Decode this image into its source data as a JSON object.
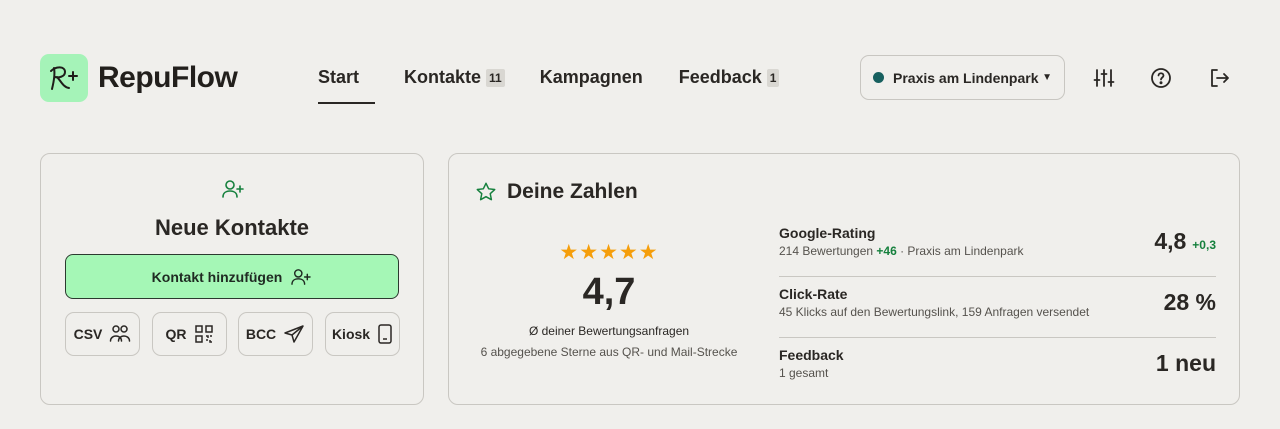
{
  "app": {
    "name": "RepuFlow",
    "logo_icon": "script-r-sparkle-icon"
  },
  "nav": {
    "items": [
      {
        "label": "Start",
        "active": true
      },
      {
        "label": "Kontakte",
        "badge": "11"
      },
      {
        "label": "Kampagnen"
      },
      {
        "label": "Feedback",
        "badge": "1"
      }
    ]
  },
  "header": {
    "practice_select": {
      "value": "Praxis am Lindenpark",
      "status_color": "#17605f"
    },
    "icons": [
      "sliders-icon",
      "help-icon",
      "logout-icon"
    ]
  },
  "contacts_card": {
    "title": "Neue Kontakte",
    "add_button": "Kontakt hinzufügen",
    "import_buttons": [
      {
        "label": "CSV",
        "icon": "users-icon"
      },
      {
        "label": "QR",
        "icon": "qr-code-icon"
      },
      {
        "label": "BCC",
        "icon": "send-icon"
      },
      {
        "label": "Kiosk",
        "icon": "tablet-icon"
      }
    ]
  },
  "stats_card": {
    "title": "Deine Zahlen",
    "average": {
      "stars": "★★★★★",
      "star_count": 5,
      "value": "4,7",
      "label": "Ø deiner Bewertungsanfragen",
      "sub": "6 abgegebene Sterne aus QR- und Mail-Strecke"
    },
    "metrics": [
      {
        "label": "Google-Rating",
        "sub_prefix": "214 Bewertungen ",
        "sub_highlight": "+46",
        "sub_suffix": " · Praxis am Lindenpark",
        "value": "4,8",
        "delta": "+0,3"
      },
      {
        "label": "Click-Rate",
        "sub": "45 Klicks auf den Bewertungslink, 159 Anfragen versendet",
        "value": "28 %"
      },
      {
        "label": "Feedback",
        "sub": "1 gesamt",
        "value": "1 neu"
      }
    ]
  },
  "colors": {
    "accent_green": "#a5f7b6",
    "positive": "#15803d",
    "star": "#f59e0b",
    "background": "#f0efec"
  }
}
